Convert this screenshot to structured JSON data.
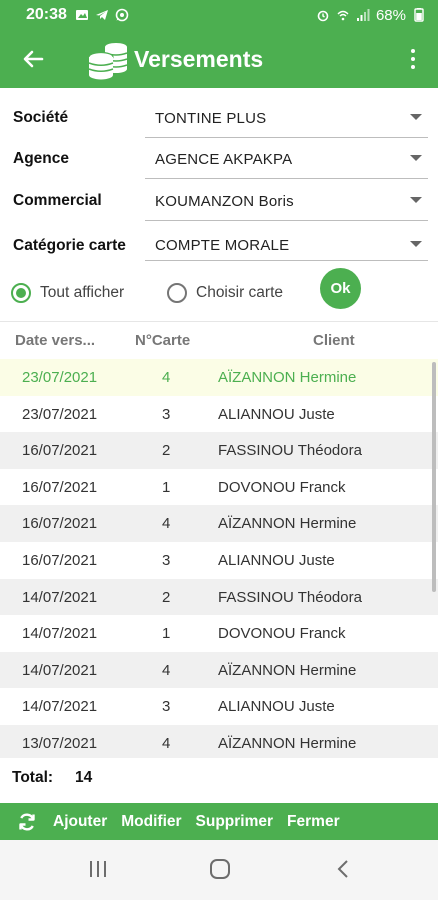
{
  "status_bar": {
    "time": "20:38",
    "battery": "68%",
    "icons_left": [
      "image-icon",
      "telegram-icon",
      "whatsapp-icon"
    ],
    "icons_right": [
      "alarm-icon",
      "wifi-calling-icon",
      "signal-icon",
      "battery-icon"
    ]
  },
  "app_bar": {
    "title": "Versements",
    "icon": "coins-icon",
    "back_icon": "back-arrow-icon",
    "menu_icon": "more-vert-icon"
  },
  "form": {
    "societe": {
      "label": "Société",
      "value": "TONTINE PLUS"
    },
    "agence": {
      "label": "Agence",
      "value": "AGENCE AKPAKPA"
    },
    "commercial": {
      "label": "Commercial",
      "value": "KOUMANZON Boris"
    },
    "categorie": {
      "label": "Catégorie carte",
      "value": "COMPTE MORALE"
    }
  },
  "filter": {
    "option_all": "Tout afficher",
    "option_choose": "Choisir carte",
    "selected": "all",
    "ok_label": "Ok"
  },
  "table": {
    "headers": {
      "date": "Date vers...",
      "num": "N°Carte",
      "client": "Client"
    },
    "rows": [
      {
        "date": "23/07/2021",
        "num": "4",
        "client": "AÏZANNON Hermine",
        "selected": true
      },
      {
        "date": "23/07/2021",
        "num": "3",
        "client": "ALIANNOU Juste"
      },
      {
        "date": "16/07/2021",
        "num": "2",
        "client": "FASSINOU Théodora"
      },
      {
        "date": "16/07/2021",
        "num": "1",
        "client": "DOVONOU Franck"
      },
      {
        "date": "16/07/2021",
        "num": "4",
        "client": "AÏZANNON Hermine"
      },
      {
        "date": "16/07/2021",
        "num": "3",
        "client": "ALIANNOU Juste"
      },
      {
        "date": "14/07/2021",
        "num": "2",
        "client": "FASSINOU Théodora"
      },
      {
        "date": "14/07/2021",
        "num": "1",
        "client": "DOVONOU Franck"
      },
      {
        "date": "14/07/2021",
        "num": "4",
        "client": "AÏZANNON Hermine"
      },
      {
        "date": "14/07/2021",
        "num": "3",
        "client": "ALIANNOU Juste"
      },
      {
        "date": "13/07/2021",
        "num": "4",
        "client": "AÏZANNON Hermine"
      }
    ]
  },
  "total": {
    "label": "Total:",
    "value": "14"
  },
  "toolbar": {
    "refresh_icon": "refresh-icon",
    "add": "Ajouter",
    "edit": "Modifier",
    "delete": "Supprimer",
    "close": "Fermer"
  },
  "colors": {
    "primary": "#4caf50",
    "selected_row_bg": "#fbfde6",
    "alt_row_bg": "#f0f0f0"
  }
}
